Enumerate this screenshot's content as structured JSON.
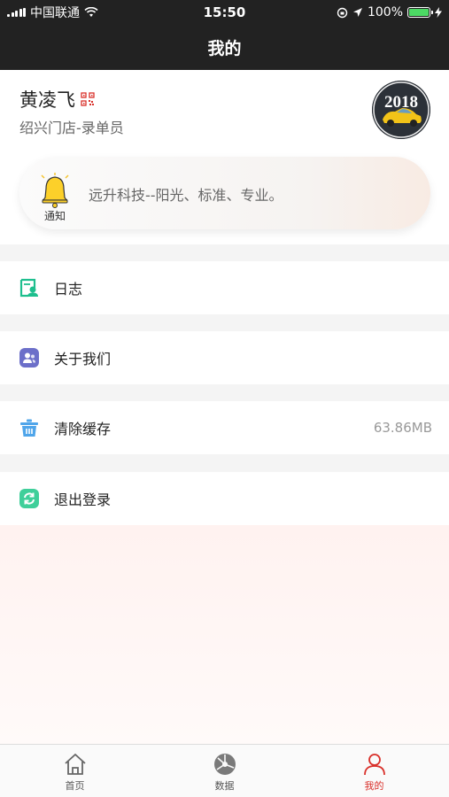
{
  "status_bar": {
    "carrier": "中国联通",
    "time": "15:50",
    "battery": "100%",
    "battery_level": 1.0,
    "battery_color": "#4cd964"
  },
  "nav": {
    "title": "我的"
  },
  "profile": {
    "name": "黄凌飞",
    "role": "绍兴门店-录单员",
    "avatar_text": "2018",
    "qr_icon": "qr-code-icon"
  },
  "notice": {
    "label": "通知",
    "text": "远升科技--阳光、标准、专业。",
    "icon": "bell-icon"
  },
  "menu": [
    {
      "label": "日志",
      "icon": "log-icon",
      "color": "#1ebf8e"
    },
    {
      "label": "关于我们",
      "icon": "about-us-icon",
      "color": "#6c6fc9"
    },
    {
      "label": "清除缓存",
      "icon": "trash-icon",
      "color": "#4fa5ea",
      "value": "63.86MB"
    },
    {
      "label": "退出登录",
      "icon": "logout-icon",
      "color": "#3fcf9a"
    }
  ],
  "tabs": [
    {
      "label": "首页",
      "icon": "home-icon",
      "active": false
    },
    {
      "label": "数据",
      "icon": "data-icon",
      "active": false
    },
    {
      "label": "我的",
      "icon": "user-icon",
      "active": true
    }
  ],
  "colors": {
    "header_bg": "#222222",
    "accent": "#d9302a"
  }
}
